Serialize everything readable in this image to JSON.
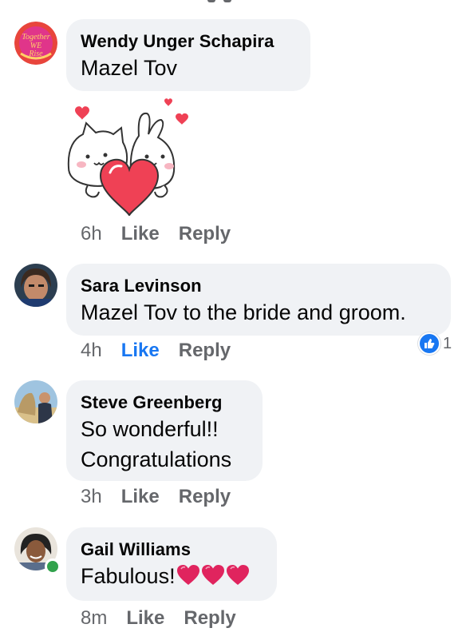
{
  "comments": [
    {
      "author": "Wendy Unger Schapira",
      "text": "Mazel Tov",
      "time": "6h",
      "like_label": "Like",
      "reply_label": "Reply",
      "sticker": "cat-and-bunny-hugging-heart-sticker",
      "avatar_text": "Together We Rise"
    },
    {
      "author": "Sara Levinson",
      "text": "Mazel Tov to the bride and groom.",
      "time": "4h",
      "like_label": "Like",
      "reply_label": "Reply",
      "liked": true,
      "reaction_count": "1"
    },
    {
      "author": "Steve Greenberg",
      "text_line1": "So wonderful!!",
      "text_line2": "Congratulations",
      "time": "3h",
      "like_label": "Like",
      "reply_label": "Reply"
    },
    {
      "author": "Gail Williams",
      "text": "Fabulous!",
      "emoji": [
        "heart",
        "heart",
        "heart"
      ],
      "time": "8m",
      "like_label": "Like",
      "reply_label": "Reply",
      "online": true
    }
  ],
  "colors": {
    "bubble": "#f0f2f5",
    "meta_text": "#65676b",
    "like_active": "#1877f2",
    "heart": "#e0245e",
    "online": "#31a24c"
  }
}
